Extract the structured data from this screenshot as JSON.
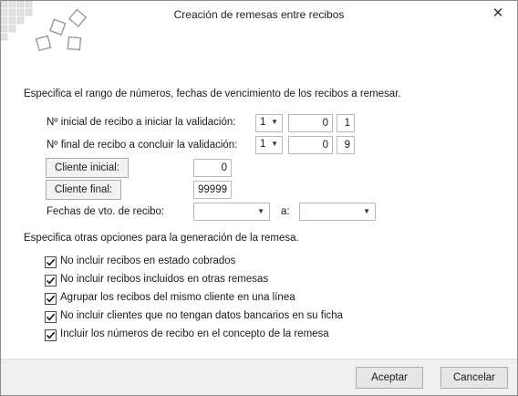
{
  "window": {
    "title": "Creación de remesas entre recibos",
    "close_icon": "close-icon"
  },
  "section1": {
    "heading": "Especifica el rango de números, fechas de vencimiento de los recibos a remesar."
  },
  "range": {
    "initial_label": "Nº inicial de recibo a iniciar la validación:",
    "initial_series": "1",
    "initial_middle": "0",
    "initial_number": "1",
    "final_label": "Nº final de recibo a concluir la validación:",
    "final_series": "1",
    "final_middle": "0",
    "final_number": "9"
  },
  "clients": {
    "initial_button": "Cliente inicial:",
    "initial_value": "0",
    "final_button": "Cliente final:",
    "final_value": "99999"
  },
  "dates": {
    "label": "Fechas de vto. de recibo:",
    "to_label": "a:",
    "from_value": "",
    "to_value": ""
  },
  "section2": {
    "heading": "Especifica otras opciones para la generación de la remesa."
  },
  "options": [
    {
      "label": "No incluir recibos en estado cobrados",
      "checked": true
    },
    {
      "label": "No incluir recibos incluidos en otras remesas",
      "checked": true
    },
    {
      "label": "Agrupar los recibos del mismo cliente en una línea",
      "checked": true
    },
    {
      "label": "No incluir clientes que no tengan datos bancarios en su ficha",
      "checked": true
    },
    {
      "label": "Incluir los números de recibo en el concepto de la remesa",
      "checked": true
    }
  ],
  "footer": {
    "accept": "Aceptar",
    "cancel": "Cancelar"
  },
  "colors": {
    "accent": "#4a4a4a",
    "footer_bg": "#f0f0f0"
  }
}
